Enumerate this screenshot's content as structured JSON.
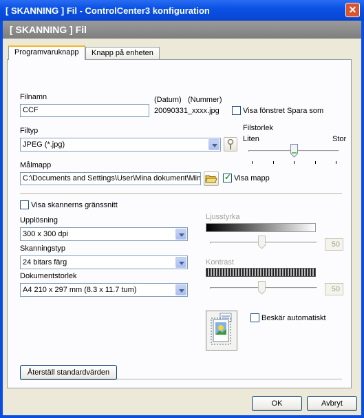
{
  "window": {
    "title": "[ SKANNING ]  Fil - ControlCenter3 konfiguration",
    "header": "[ SKANNING ]  Fil",
    "close_glyph": "✕"
  },
  "tabs": [
    {
      "label": "Programvaruknapp",
      "active": true
    },
    {
      "label": "Knapp på enheten",
      "active": false
    }
  ],
  "filename": {
    "label": "Filnamn",
    "value": "CCF",
    "date_label": "(Datum)",
    "number_label": "(Nummer)",
    "suffix": "20090331_xxxx.jpg",
    "show_save_as_label": "Visa fönstret Spara som",
    "show_save_as_checked": false
  },
  "filetype": {
    "label": "Filtyp",
    "value": "JPEG (*.jpg)"
  },
  "filesize": {
    "label": "Filstorlek",
    "min_label": "Liten",
    "max_label": "Stor",
    "level": 0.5
  },
  "destination": {
    "label": "Målmapp",
    "value": "C:\\Documents and Settings\\User\\Mina dokument\\Min",
    "show_folder_label": "Visa mapp",
    "show_folder_checked": true
  },
  "scanner_ui": {
    "label": "Visa skannerns gränssnitt",
    "checked": false
  },
  "resolution": {
    "label": "Upplösning",
    "value": "300 x 300 dpi"
  },
  "scan_type": {
    "label": "Skanningstyp",
    "value": "24 bitars färg"
  },
  "doc_size": {
    "label": "Dokumentstorlek",
    "value": "A4 210 x 297 mm (8.3 x 11.7 tum)"
  },
  "brightness": {
    "label": "Ljusstyrka",
    "value": "50",
    "level": 0.5
  },
  "contrast": {
    "label": "Kontrast",
    "value": "50",
    "level": 0.5
  },
  "auto_crop": {
    "label": "Beskär automatiskt",
    "checked": false
  },
  "buttons": {
    "reset": "Återställ standardvärden",
    "ok": "OK",
    "cancel": "Avbryt"
  },
  "colors": {
    "titlebar": "#0a52e6",
    "header_band": "#8a8a8a",
    "dialog_bg": "#ece9d8",
    "tab_highlight": "#f5b82a"
  },
  "icons": {
    "browse": "folder-open-icon",
    "settings": "wrench-icon",
    "preview": "scanned-document-icon"
  }
}
